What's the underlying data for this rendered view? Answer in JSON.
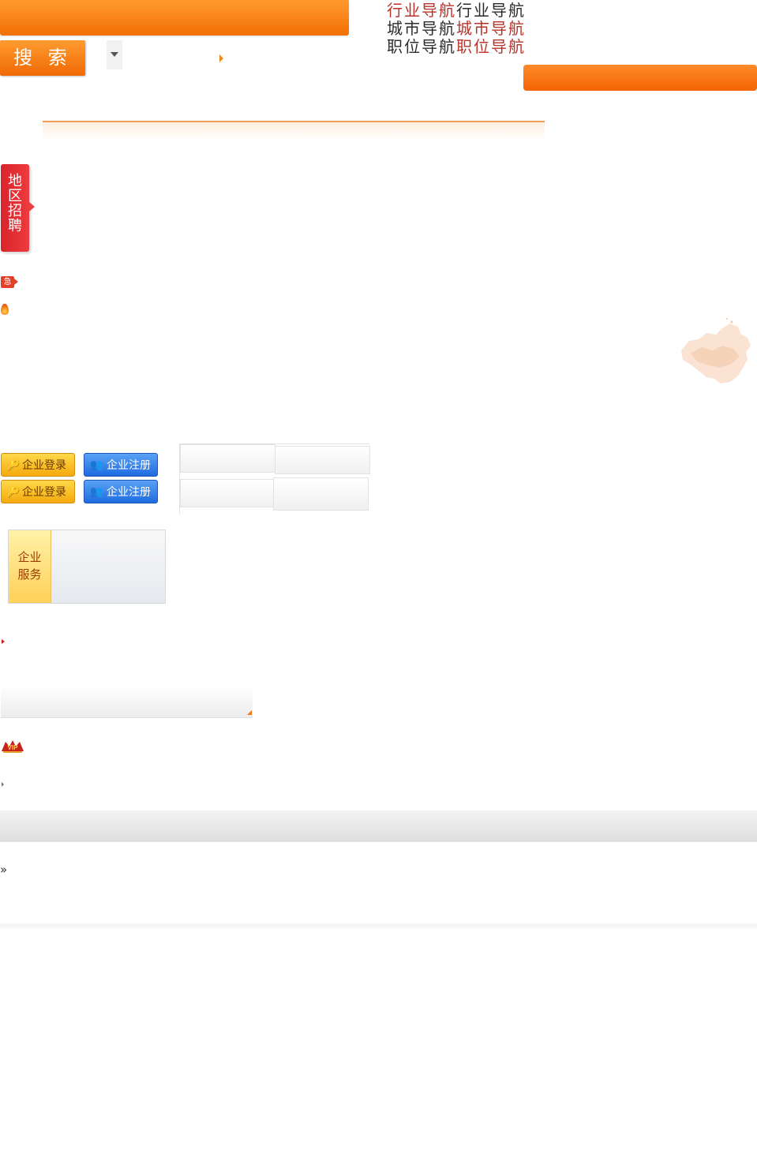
{
  "search": {
    "button_label": "搜 索"
  },
  "nav": {
    "rows": [
      [
        {
          "text": "行业导航",
          "color": "#b7332a"
        },
        {
          "text": "行业导航",
          "color": "#2b2b2b"
        }
      ],
      [
        {
          "text": "城市导航",
          "color": "#2b2b2b"
        },
        {
          "text": "城市导航",
          "color": "#b7332a"
        }
      ],
      [
        {
          "text": "职位导航",
          "color": "#2b2b2b"
        },
        {
          "text": "职位导航",
          "color": "#b7332a"
        }
      ]
    ]
  },
  "region_tab": {
    "label": "地区招聘"
  },
  "urgent_icon": {
    "label": "急"
  },
  "enterprise": {
    "login_label": "企业登录",
    "register_label": "企业注册"
  },
  "service": {
    "label_line1": "企业",
    "label_line2": "服务"
  },
  "vip": {
    "label": "VIP"
  },
  "more": {
    "symbol": "»"
  },
  "colors": {
    "accent_orange": "#f36f04",
    "accent_red": "#d8242b",
    "accent_blue": "#1f6be0",
    "accent_yellow": "#f4a90d"
  }
}
